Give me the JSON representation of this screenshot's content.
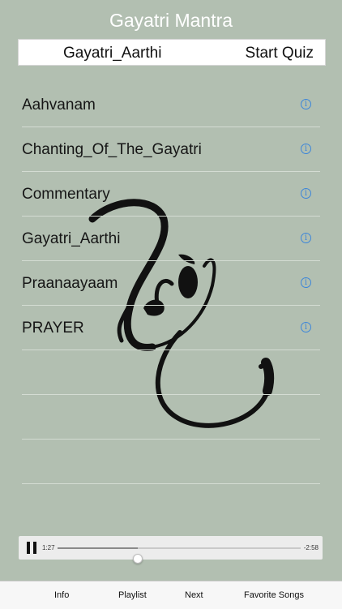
{
  "app_title": "Gayatri Mantra",
  "header": {
    "current_track": "Gayatri_Aarthi",
    "quiz_label": "Start Quiz"
  },
  "songs": [
    {
      "label": "Aahvanam",
      "info_icon": "info-circle-icon"
    },
    {
      "label": "Chanting_Of_The_Gayatri",
      "info_icon": "info-circle-icon"
    },
    {
      "label": "Commentary",
      "info_icon": "info-circle-icon"
    },
    {
      "label": "Gayatri_Aarthi",
      "info_icon": "info-circle-icon"
    },
    {
      "label": "Praanaayaam",
      "info_icon": "info-circle-icon"
    },
    {
      "label": "PRAYER",
      "info_icon": "info-circle-icon"
    }
  ],
  "info_glyph": "i",
  "player": {
    "elapsed": "1:27",
    "remaining": "-2:58",
    "progress": 0.33,
    "state": "playing"
  },
  "tabs": {
    "info": "Info",
    "playlist": "Playlist",
    "next": "Next",
    "favorites": "Favorite Songs"
  },
  "colors": {
    "background": "#b2bfb1",
    "accent": "#3d86d9",
    "title_text": "#ffffff"
  }
}
